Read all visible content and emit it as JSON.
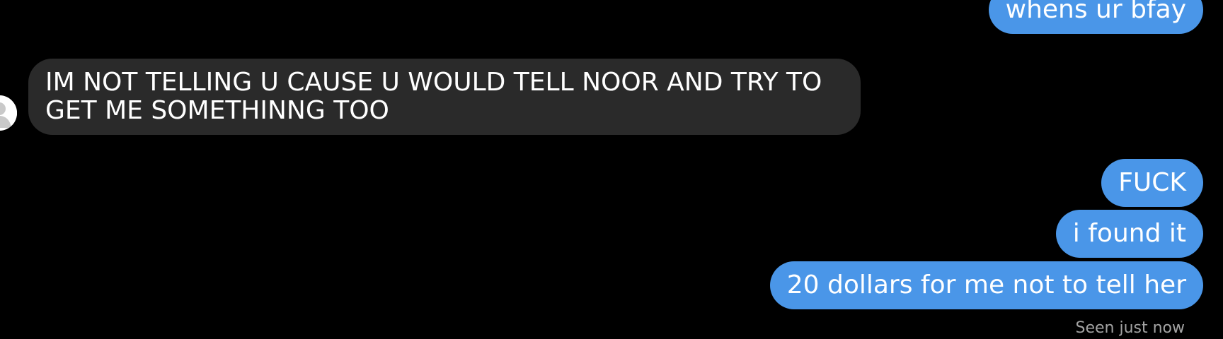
{
  "conversation": {
    "messages": [
      {
        "sender": "me",
        "text": "whens ur bfay"
      },
      {
        "sender": "contact",
        "text": "IM NOT TELLING U CAUSE U WOULD TELL NOOR AND TRY TO GET ME SOMETHINNG TOO"
      },
      {
        "sender": "me",
        "text": "FUCK"
      },
      {
        "sender": "me",
        "text": "i found it"
      },
      {
        "sender": "me",
        "text": "20 dollars for me not to tell her"
      }
    ],
    "seen_status": "Seen just now"
  },
  "colors": {
    "background": "#000000",
    "outgoing_bubble": "#4a96e8",
    "incoming_bubble": "#2a2a2a",
    "seen_text": "#a3a3a3"
  },
  "icons": {
    "contact_avatar": "default-avatar-icon"
  }
}
